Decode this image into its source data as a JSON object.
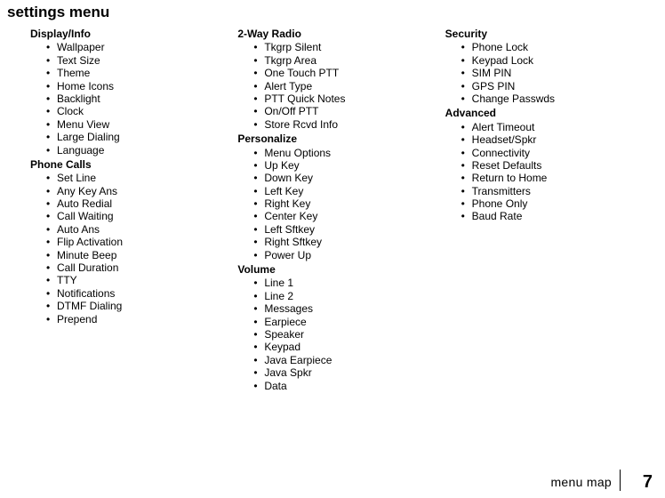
{
  "page": {
    "title": "settings menu",
    "footer_label": "menu map",
    "footer_number": "7"
  },
  "columns": [
    {
      "groups": [
        {
          "title": "Display/Info",
          "items": [
            "Wallpaper",
            "Text Size",
            "Theme",
            "Home Icons",
            "Backlight",
            "Clock",
            "Menu View",
            "Large Dialing",
            "Language"
          ]
        },
        {
          "title": "Phone Calls",
          "items": [
            "Set Line",
            "Any Key Ans",
            "Auto Redial",
            "Call Waiting",
            "Auto Ans",
            "Flip Activation",
            "Minute Beep",
            "Call Duration",
            "TTY",
            "Notifications",
            "DTMF Dialing",
            "Prepend"
          ]
        }
      ]
    },
    {
      "groups": [
        {
          "title": "2-Way Radio",
          "items": [
            "Tkgrp Silent",
            "Tkgrp Area",
            "One Touch PTT",
            "Alert Type",
            "PTT Quick Notes",
            "On/Off PTT",
            "Store Rcvd Info"
          ]
        },
        {
          "title": "Personalize",
          "items": [
            "Menu Options",
            "Up Key",
            "Down Key",
            "Left Key",
            "Right Key",
            "Center Key",
            "Left Sftkey",
            "Right Sftkey",
            "Power Up"
          ]
        },
        {
          "title": "Volume",
          "items": [
            "Line 1",
            "Line 2",
            "Messages",
            "Earpiece",
            "Speaker",
            "Keypad",
            "Java Earpiece",
            "Java Spkr",
            "Data"
          ]
        }
      ]
    },
    {
      "groups": [
        {
          "title": "Security",
          "items": [
            "Phone Lock",
            "Keypad Lock",
            "SIM PIN",
            "GPS PIN",
            "Change Passwds"
          ]
        },
        {
          "title": "Advanced",
          "items": [
            "Alert Timeout",
            "Headset/Spkr",
            "Connectivity",
            "Reset Defaults",
            "Return to Home",
            "Transmitters",
            "Phone Only",
            "Baud Rate"
          ]
        }
      ]
    }
  ]
}
